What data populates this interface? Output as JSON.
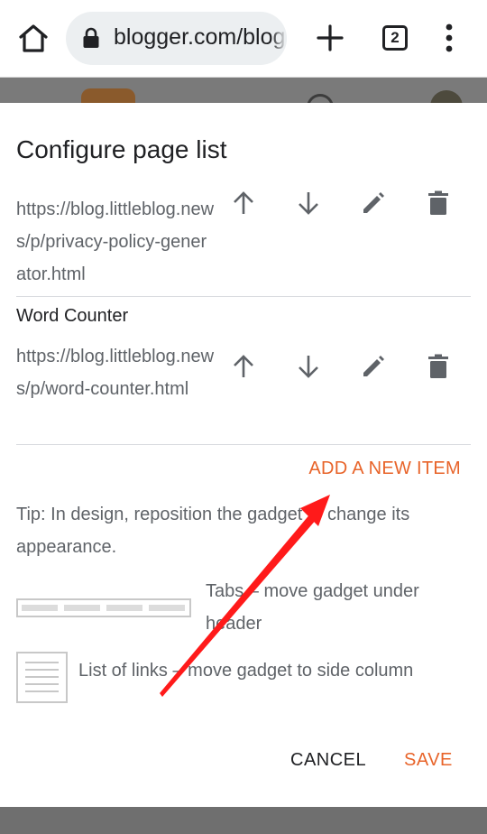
{
  "browser": {
    "url": "blogger.com/blog",
    "tab_count": "2",
    "icons": {
      "home": "home-icon",
      "lock": "lock-icon",
      "new_tab": "plus-icon",
      "menu": "more-vert-icon"
    }
  },
  "dialog": {
    "title": "Configure page list",
    "items": [
      {
        "name": "",
        "url": "https://blog.littleblog.news/p/privacy-policy-generator.html"
      },
      {
        "name": "Word Counter",
        "url": "https://blog.littleblog.news/p/word-counter.html"
      }
    ],
    "add_item_label": "ADD A NEW ITEM",
    "tip": "Tip: In design, reposition the gadget to change its appearance.",
    "layout_options": {
      "tabs": "Tabs – move gadget under header",
      "list": "List of links – move gadget to side column"
    },
    "cancel_label": "CANCEL",
    "save_label": "SAVE"
  },
  "colors": {
    "accent": "#e8642a",
    "annotation_arrow": "#ff1a1a",
    "overlay": "#7a7a7a"
  }
}
